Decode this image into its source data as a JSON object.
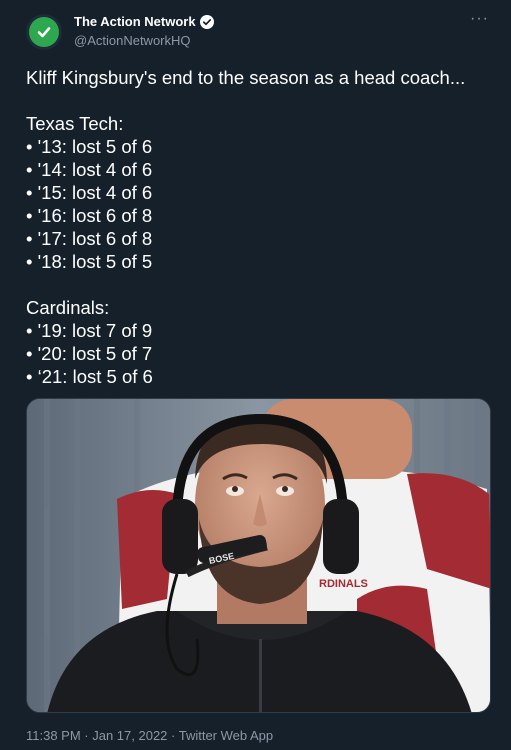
{
  "author": {
    "display_name": "The Action Network",
    "handle": "@ActionNetworkHQ"
  },
  "tweet": {
    "lines": [
      "Kliff Kingsbury's end to the season as a head coach...",
      "",
      "Texas Tech:",
      "• '13: lost 5 of 6",
      "• '14: lost 4 of 6",
      "• '15: lost 4 of 6",
      "• '16: lost 6 of 8",
      "• '17: lost 6 of 8",
      "• '18: lost 5 of 5",
      "",
      "Cardinals:",
      "• '19: lost 7 of 9",
      "• '20: lost 5 of 7",
      "• ‘21: lost 5 of 6"
    ]
  },
  "media": {
    "headset_text": "BOSE",
    "jersey_text": "RDINALS"
  },
  "meta": {
    "text": "11:38 PM · Jan 17, 2022 · Twitter Web App"
  },
  "colors": {
    "background": "#15202b",
    "secondary_text": "#8b98a5",
    "verified": "#ffffff",
    "avatar_green": "#2ea84f"
  },
  "icons": {
    "avatar": "action-network-checkmark-logo",
    "verified": "verified-badge-icon",
    "more": "more-options-icon"
  }
}
